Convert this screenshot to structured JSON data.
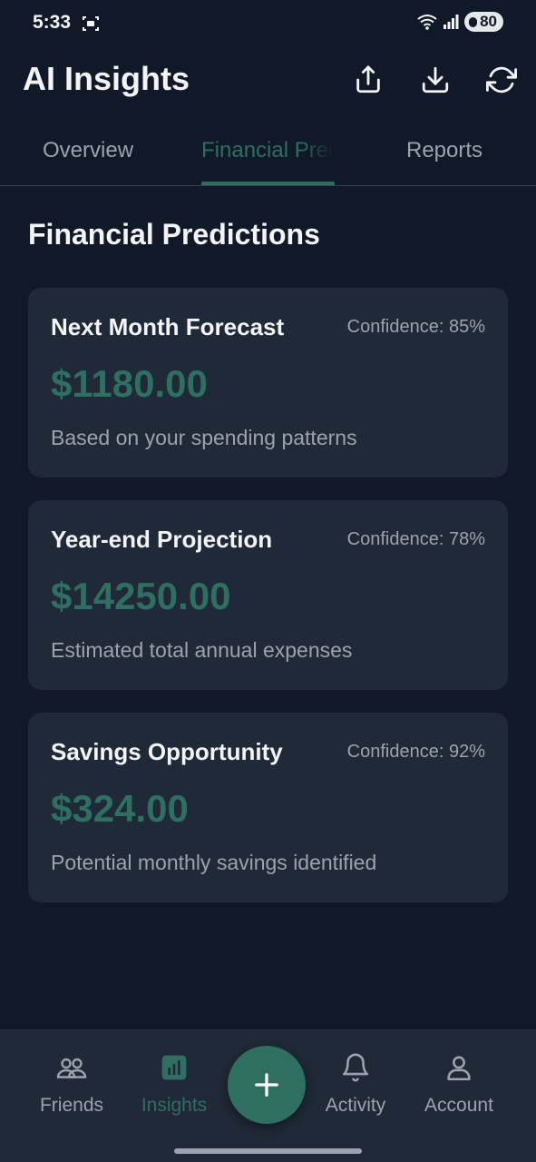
{
  "status_bar": {
    "time": "5:33",
    "battery": "80"
  },
  "header": {
    "title": "AI Insights"
  },
  "tabs": [
    {
      "label": "Overview"
    },
    {
      "label": "Financial Predictions"
    },
    {
      "label": "Reports"
    }
  ],
  "active_tab_index": 1,
  "section": {
    "title": "Financial Predictions"
  },
  "cards": [
    {
      "title": "Next Month Forecast",
      "confidence": "Confidence: 85%",
      "amount": "$1180.00",
      "description": "Based on your spending patterns"
    },
    {
      "title": "Year-end Projection",
      "confidence": "Confidence: 78%",
      "amount": "$14250.00",
      "description": "Estimated total annual expenses"
    },
    {
      "title": "Savings Opportunity",
      "confidence": "Confidence: 92%",
      "amount": "$324.00",
      "description": "Potential monthly savings identified"
    }
  ],
  "bottom_nav": [
    {
      "label": "Friends",
      "icon": "friends-icon"
    },
    {
      "label": "Insights",
      "icon": "insights-icon"
    },
    {
      "label": "Activity",
      "icon": "bell-icon"
    },
    {
      "label": "Account",
      "icon": "user-icon"
    }
  ],
  "colors": {
    "accent": "#2f6f62",
    "background": "#111827",
    "card": "#1f2937",
    "muted_text": "#9ca3af"
  }
}
